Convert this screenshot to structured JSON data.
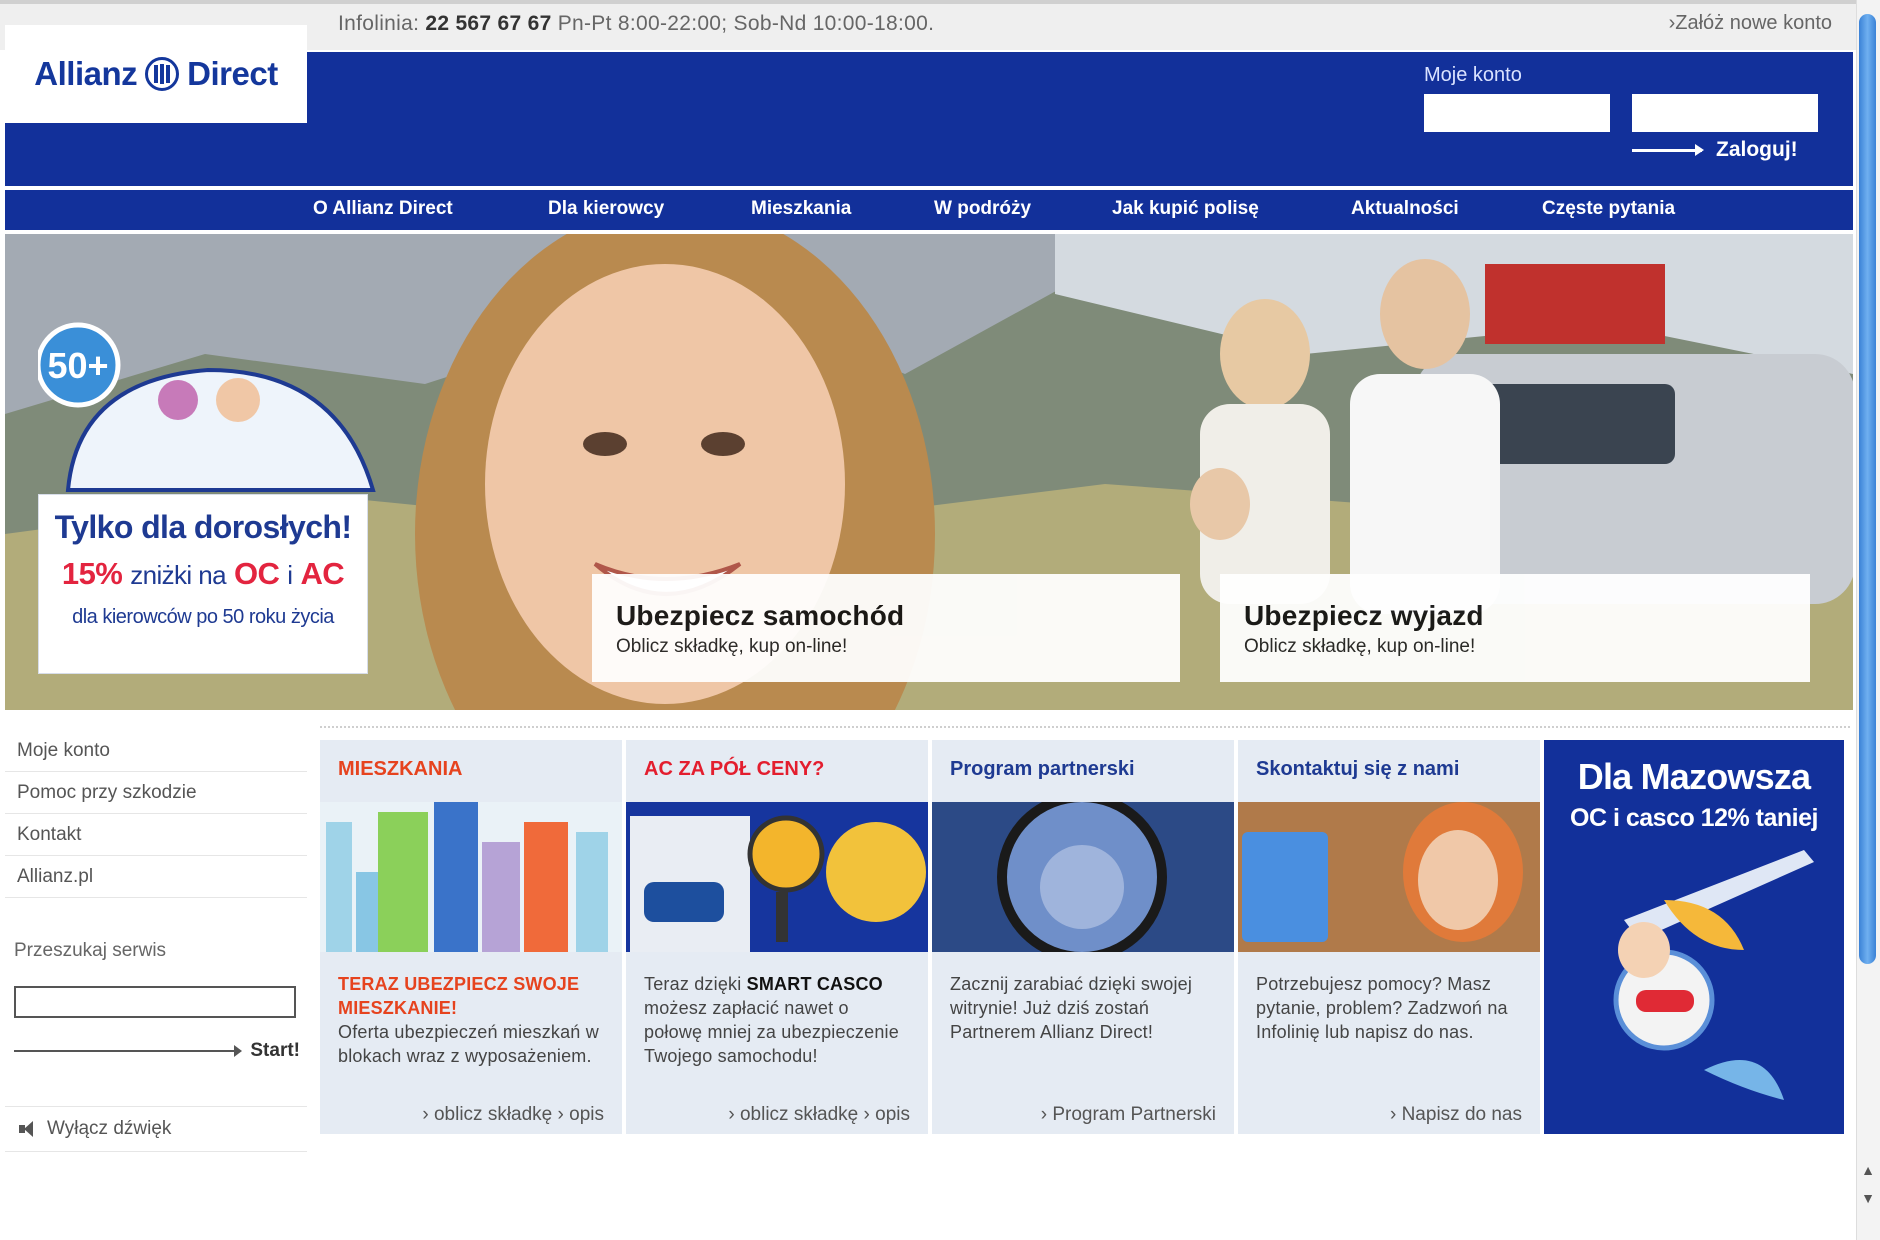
{
  "topbar": {
    "infoline_prefix": "Infolinia:",
    "infoline_phone": "22 567 67 67",
    "infoline_hours": "Pn-Pt 8:00-22:00; Sob-Nd 10:00-18:00.",
    "new_account": "›Załóż nowe konto"
  },
  "header": {
    "logo_left": "Allianz",
    "logo_right": "Direct",
    "account_label": "Moje konto",
    "login_button": "Zaloguj!"
  },
  "nav": {
    "items": [
      "O Allianz Direct",
      "Dla kierowcy",
      "Mieszkania",
      "W podróży",
      "Jak kupić polisę",
      "Aktualności",
      "Częste pytania"
    ]
  },
  "hero": {
    "promo_title": "Tylko dla dorosłych!",
    "promo_badge": "50+",
    "promo_pct": "15%",
    "promo_mid": "zniżki na",
    "promo_oc": "OC",
    "promo_i": "i",
    "promo_ac": "AC",
    "promo_sub": "dla kierowców po 50 roku życia",
    "box_car_title": "Ubezpiecz samochód",
    "box_car_sub": "Oblicz składkę, kup on-line!",
    "box_trip_title": "Ubezpiecz wyjazd",
    "box_trip_sub": "Oblicz składkę, kup on-line!"
  },
  "sidebar": {
    "links": [
      "Moje konto",
      "Pomoc przy szkodzie",
      "Kontakt",
      "Allianz.pl"
    ],
    "search_label": "Przeszukaj serwis",
    "search_button": "Start!",
    "sound_toggle": "Wyłącz dźwięk"
  },
  "cards": [
    {
      "title": "MIESZKANIA",
      "body_head": "TERAZ UBEZPIECZ SWOJE MIESZKANIE!",
      "body": "Oferta ubezpieczeń mieszkań w blokach wraz z wyposażeniem.",
      "link1": "› oblicz składkę",
      "link2": "› opis"
    },
    {
      "title": "AC ZA PÓŁ CENY?",
      "body_pre": "Teraz dzięki",
      "body_bold": "SMART CASCO",
      "body": "możesz zapłacić nawet o połowę mniej za ubezpieczenie Twojego samochodu!",
      "link1": "› oblicz składkę",
      "link2": "› opis"
    },
    {
      "title": "Program partnerski",
      "body": "Zacznij zarabiać dzięki swojej witrynie! Już dziś zostań Partnerem Allianz Direct!",
      "link1": "› Program Partnerski"
    },
    {
      "title": "Skontaktuj się z nami",
      "body": "Potrzebujesz pomocy? Masz pytanie, problem? Zadzwoń na Infolinię lub napisz do nas.",
      "link1": "› Napisz do nas"
    }
  ],
  "mazowsze": {
    "title": "Dla Mazowsza",
    "subtitle": "OC i casco 12% taniej"
  },
  "colors": {
    "brand_blue": "#12309a",
    "accent_orange": "#e6431e",
    "accent_red": "#e31e2e",
    "card_bg": "#e5ebf3"
  }
}
